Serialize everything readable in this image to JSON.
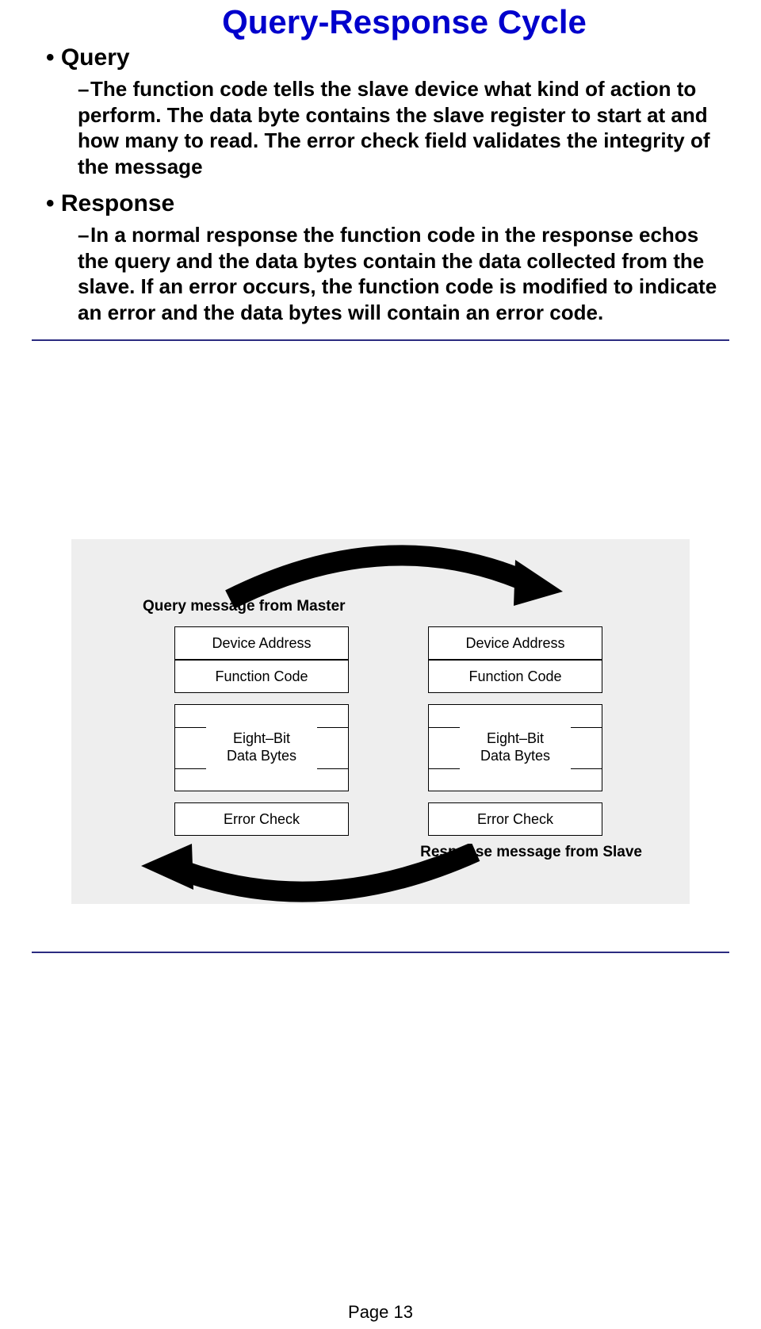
{
  "title": "Query-Response Cycle",
  "bullet1": {
    "label": "Query",
    "sub": "The function code tells the slave device what kind of action to perform.  The data byte contains the slave register to start at and how many to read.  The error check field validates the integrity of the message"
  },
  "bullet2": {
    "label": "Response",
    "sub": "In a normal response the function code in the response echos the query and the data bytes contain the data collected from the slave.  If an error occurs, the function code is modified to indicate an error and the data bytes will contain an error code."
  },
  "diagram": {
    "caption_top": "Query message from Master",
    "caption_bottom": "Response message from Slave",
    "cells": {
      "device_address": "Device Address",
      "function_code": "Function Code",
      "data_bytes": "Eight–Bit\nData Bytes",
      "error_check": "Error Check"
    }
  },
  "footer": "Page 13"
}
